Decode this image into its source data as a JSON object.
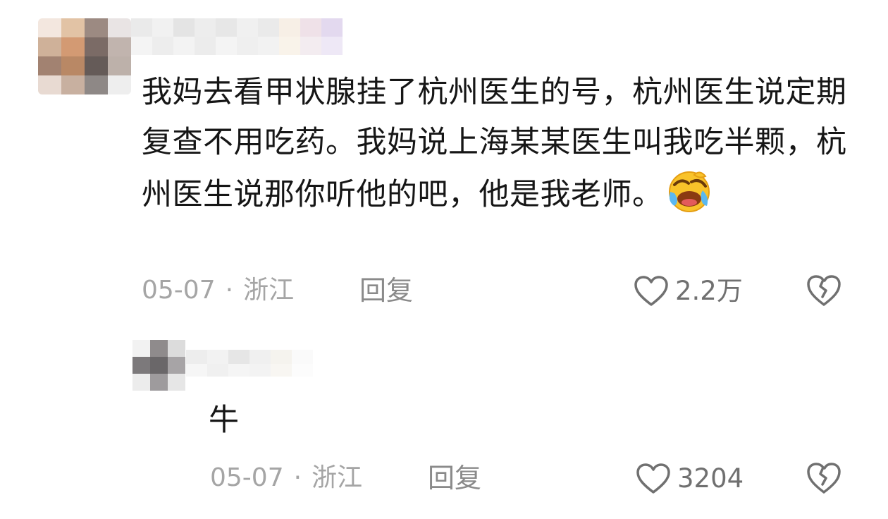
{
  "comment": {
    "text": "我妈去看甲状腺挂了杭州医生的号，杭州医生说定期复查不用吃药。我妈说上海某某医生叫我吃半颗，杭州医生说那你听他的吧，他是我老师。",
    "emoji": "laugh-cry-emoji",
    "date": "05-07",
    "location": "浙江",
    "reply_label": "回复",
    "likes": "2.2万"
  },
  "reply": {
    "text": "牛",
    "date": "05-07",
    "location": "浙江",
    "reply_label": "回复",
    "likes": "3204"
  },
  "separator": "·",
  "colors": {
    "text": "#161616",
    "meta": "#a5a5a5",
    "icon": "#707070"
  }
}
